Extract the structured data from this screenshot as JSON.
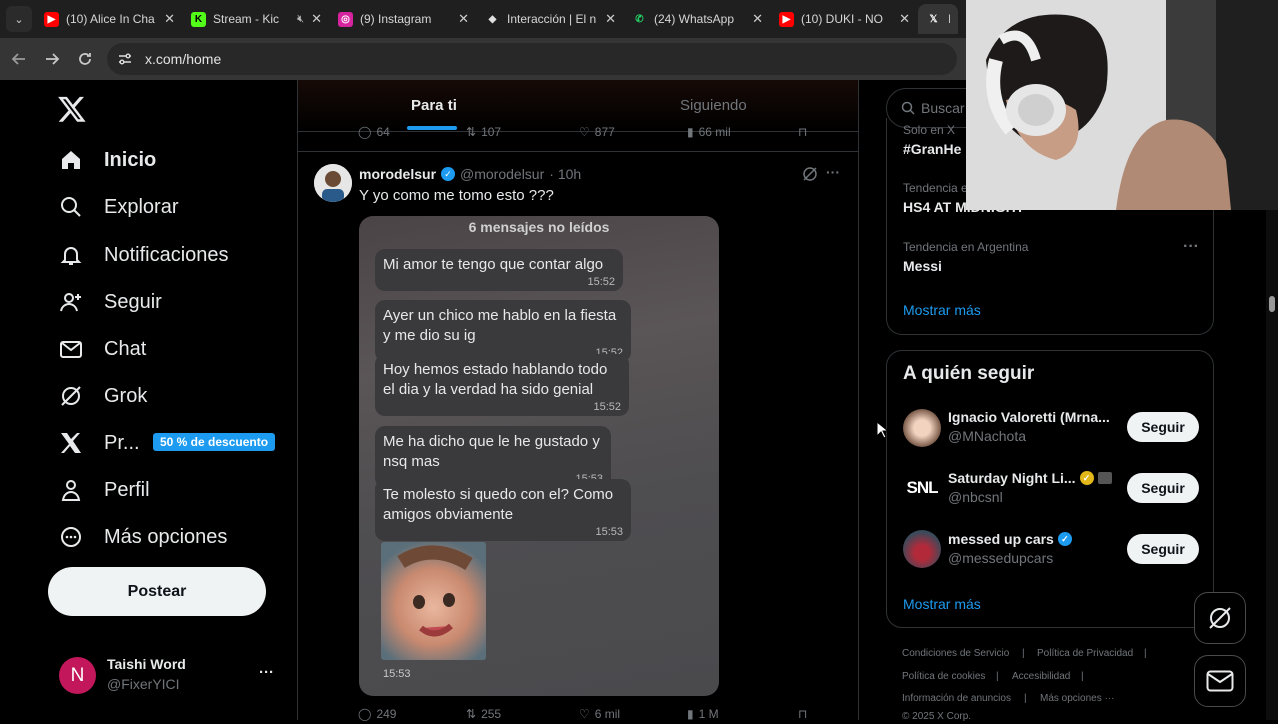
{
  "browser": {
    "tabs": [
      {
        "title": "(10) Alice In Cha",
        "icon": "youtube-icon",
        "color": "#ff0000"
      },
      {
        "title": "Stream - Kic",
        "icon": "kick-icon",
        "color": "#53fc18",
        "muted": true
      },
      {
        "title": "(9) Instagram",
        "icon": "instagram-icon",
        "color": "#d6249f"
      },
      {
        "title": "Interacción | El n",
        "icon": "diamond-icon",
        "color": "#e0e0e0"
      },
      {
        "title": "(24) WhatsApp",
        "icon": "whatsapp-icon",
        "color": "#25d366"
      },
      {
        "title": "(10) DUKI - NO",
        "icon": "youtube-icon",
        "color": "#ff0000"
      },
      {
        "title": "In",
        "icon": "x-icon",
        "color": "#ffffff",
        "active": true
      }
    ],
    "url": "x.com/home"
  },
  "nav": {
    "items": [
      {
        "label": "Inicio",
        "icon": "home-icon"
      },
      {
        "label": "Explorar",
        "icon": "search-icon"
      },
      {
        "label": "Notificaciones",
        "icon": "bell-icon"
      },
      {
        "label": "Seguir",
        "icon": "add-user-icon"
      },
      {
        "label": "Chat",
        "icon": "mail-icon"
      },
      {
        "label": "Grok",
        "icon": "grok-icon"
      },
      {
        "label": "Pr...",
        "icon": "x-icon"
      },
      {
        "label": "Perfil",
        "icon": "person-icon"
      },
      {
        "label": "Más opciones",
        "icon": "more-circle-icon"
      }
    ],
    "promo": "50 % de descuento",
    "post_button": "Postear",
    "account": {
      "initial": "N",
      "name": "Taishi Word",
      "handle": "@FixerYICI",
      "more": "···"
    }
  },
  "feed": {
    "tabs": [
      "Para ti",
      "Siguiendo"
    ],
    "prev_actions": {
      "replies": "64",
      "reposts": "107",
      "likes": "877",
      "views": "66 mil"
    },
    "post": {
      "name": "morodelsur",
      "handle": "@morodelsur",
      "time": "· 10h",
      "text": "Y yo como me tomo esto ???",
      "more": "···",
      "image": {
        "unread": "6 mensajes no leídos",
        "messages": [
          {
            "text": "Mi amor te tengo que contar algo",
            "time": "15:52"
          },
          {
            "text": "Ayer un chico me hablo en la fiesta y me dio su ig",
            "time": "15:52"
          },
          {
            "text": "Hoy hemos estado hablando todo el dia y la verdad ha sido genial",
            "time": "15:52"
          },
          {
            "text": "Me ha dicho que le he gustado y nsq mas",
            "time": "15:53"
          },
          {
            "text": "Te molesto si quedo con el? Como amigos obviamente",
            "time": "15:53"
          }
        ],
        "photo_time": "15:53"
      },
      "actions": {
        "replies": "249",
        "reposts": "255",
        "likes": "6 mil",
        "views": "1 M"
      }
    }
  },
  "sidebar": {
    "search_placeholder": "Buscar",
    "trends": [
      {
        "label": "Solo en X",
        "name": "#GranHe"
      },
      {
        "label": "Tendencia e",
        "name": "HS4 AT MIDNIGHT"
      },
      {
        "label": "Tendencia en Argentina",
        "name": "Messi"
      }
    ],
    "trends_more": "Mostrar más",
    "who_to_follow": {
      "title": "A quién seguir",
      "accounts": [
        {
          "name": "Ignacio Valoretti (Mrna...",
          "handle": "@MNachota",
          "button": "Seguir"
        },
        {
          "name": "Saturday Night Li...",
          "handle": "@nbcsnl",
          "button": "Seguir",
          "logo": "SNL"
        },
        {
          "name": "messed up cars",
          "handle": "@messedupcars",
          "button": "Seguir"
        }
      ],
      "more": "Mostrar más"
    },
    "footer": {
      "links": [
        "Condiciones de Servicio",
        "|",
        "Política de Privacidad",
        "|",
        "Política de cookies",
        "|",
        "Accesibilidad",
        "|",
        "Información de anuncios",
        "|",
        "Más opciones ···"
      ],
      "copyright": "© 2025 X Corp."
    }
  },
  "colors": {
    "accent": "#1d9bf0",
    "background": "#000000",
    "border": "#2f3336",
    "muted": "#71767b"
  }
}
